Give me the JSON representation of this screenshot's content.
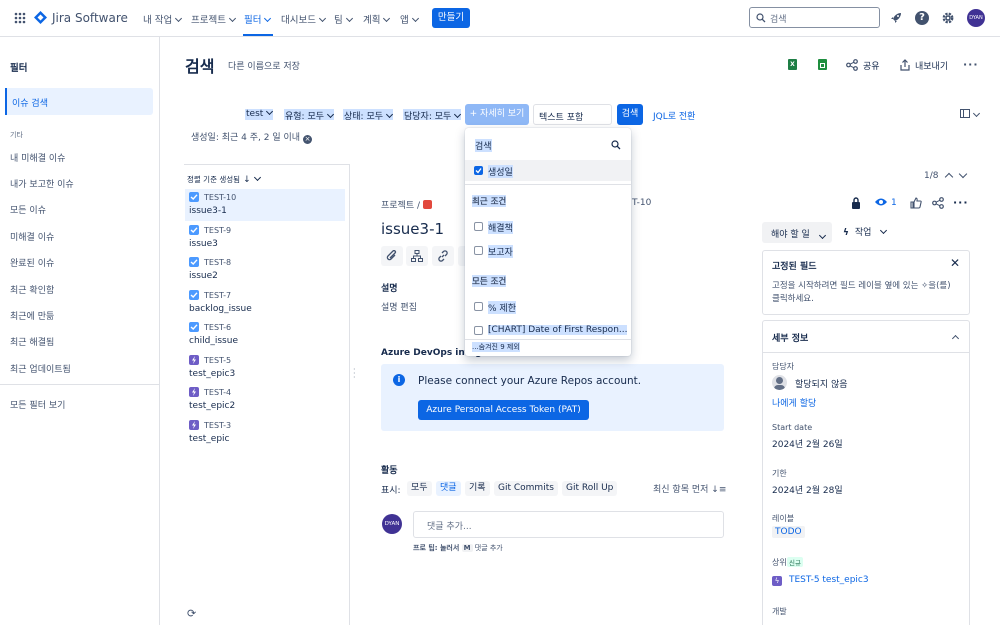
{
  "app": {
    "logo_text": "Jira Software"
  },
  "topnav": {
    "items": [
      "내 작업",
      "프로젝트",
      "필터",
      "대시보드",
      "팀",
      "계획",
      "앱"
    ],
    "create_label": "만들기",
    "search_placeholder": "검색",
    "avatar_initials": "DYAN"
  },
  "sidebar": {
    "title": "필터",
    "active": "이슈 검색",
    "section": "기타",
    "items": [
      "내 미해결 이슈",
      "내가 보고한 이슈",
      "모든 이슈",
      "미해결 이슈",
      "완료된 이슈",
      "최근 확인함",
      "최근에 만듦",
      "최근 해결됨",
      "최근 업데이트됨"
    ],
    "all_filters": "모든 필터 보기"
  },
  "header": {
    "title": "검색",
    "save_as": "다른 이름으로 저장",
    "share": "공유",
    "export": "내보내기"
  },
  "toolbar": {
    "project": "test",
    "type": "유형: 모두",
    "status": "상태: 모두",
    "assignee": "담당자: 모두",
    "more": "+ 자세히 보기",
    "text_placeholder": "텍스트 포함",
    "search_button": "검색",
    "jql": "JQL로 전환",
    "filter_chip": "생성일: 최근 4 주, 2 일 이내"
  },
  "list": {
    "sort_label": "정렬 기준 생성됨",
    "pagination": "1/8",
    "issues": [
      {
        "key": "TEST-10",
        "summary": "issue3-1",
        "type": "story"
      },
      {
        "key": "TEST-9",
        "summary": "issue3",
        "type": "story"
      },
      {
        "key": "TEST-8",
        "summary": "issue2",
        "type": "story"
      },
      {
        "key": "TEST-7",
        "summary": "backlog_issue",
        "type": "story"
      },
      {
        "key": "TEST-6",
        "summary": "child_issue",
        "type": "story"
      },
      {
        "key": "TEST-5",
        "summary": "test_epic3",
        "type": "epic"
      },
      {
        "key": "TEST-4",
        "summary": "test_epic2",
        "type": "epic"
      },
      {
        "key": "TEST-3",
        "summary": "test_epic",
        "type": "epic"
      }
    ]
  },
  "dropdown": {
    "search_placeholder": "검색",
    "selected": "생성일",
    "recent_header": "최근 조건",
    "recent_items": [
      "해결책",
      "보고자"
    ],
    "all_header": "모든 조건",
    "all_items": [
      "% 제한",
      "[CHART] Date of First Respon..."
    ],
    "hidden": "...숨겨진 9 제외"
  },
  "detail": {
    "breadcrumb_project": "프로젝트",
    "breadcrumb_key": "T-10",
    "title": "issue3-1",
    "watchers": "1",
    "description_label": "설명",
    "description_edit": "설명 편집",
    "azure_header": "Azure DevOps integ",
    "azure_message": "Please connect your Azure Repos account.",
    "azure_button": "Azure Personal Access Token (PAT)",
    "activity_label": "활동",
    "show_label": "표시:",
    "activity_tabs": [
      "모두",
      "댓글",
      "기록",
      "Git Commits",
      "Git Roll Up"
    ],
    "order_label": "최신 항목 먼저",
    "comment_placeholder": "댓글 추가...",
    "pro_tip_prefix": "프로 팁: 눌러서",
    "pro_tip_key": "M",
    "pro_tip_suffix": "댓글 추가"
  },
  "right": {
    "status_button": "해야 할 일",
    "action_button": "작업",
    "pinned_title": "고정된 필드",
    "pinned_text": "고정을 시작하려면 필드 레이블 옆에 있는 ✧을(를) 클릭하세요.",
    "details_title": "세부 정보",
    "assignee_label": "담당자",
    "assignee_value": "할당되지 않음",
    "assign_me": "나에게 할당",
    "start_label": "Start date",
    "start_value": "2024년 2월 26일",
    "due_label": "기한",
    "due_value": "2024년 2월 28일",
    "labels_label": "레이블",
    "labels_value": "TODO",
    "parent_label": "상위",
    "parent_badge": "신규",
    "parent_value": "TEST-5 test_epic3",
    "dev_label": "개발"
  },
  "colors": {
    "primary": "#0c66e4",
    "selection": "#cce0ff",
    "epic": "#6e5dc6",
    "story": "#4c9aff",
    "subtask_red": "#e2483d"
  }
}
